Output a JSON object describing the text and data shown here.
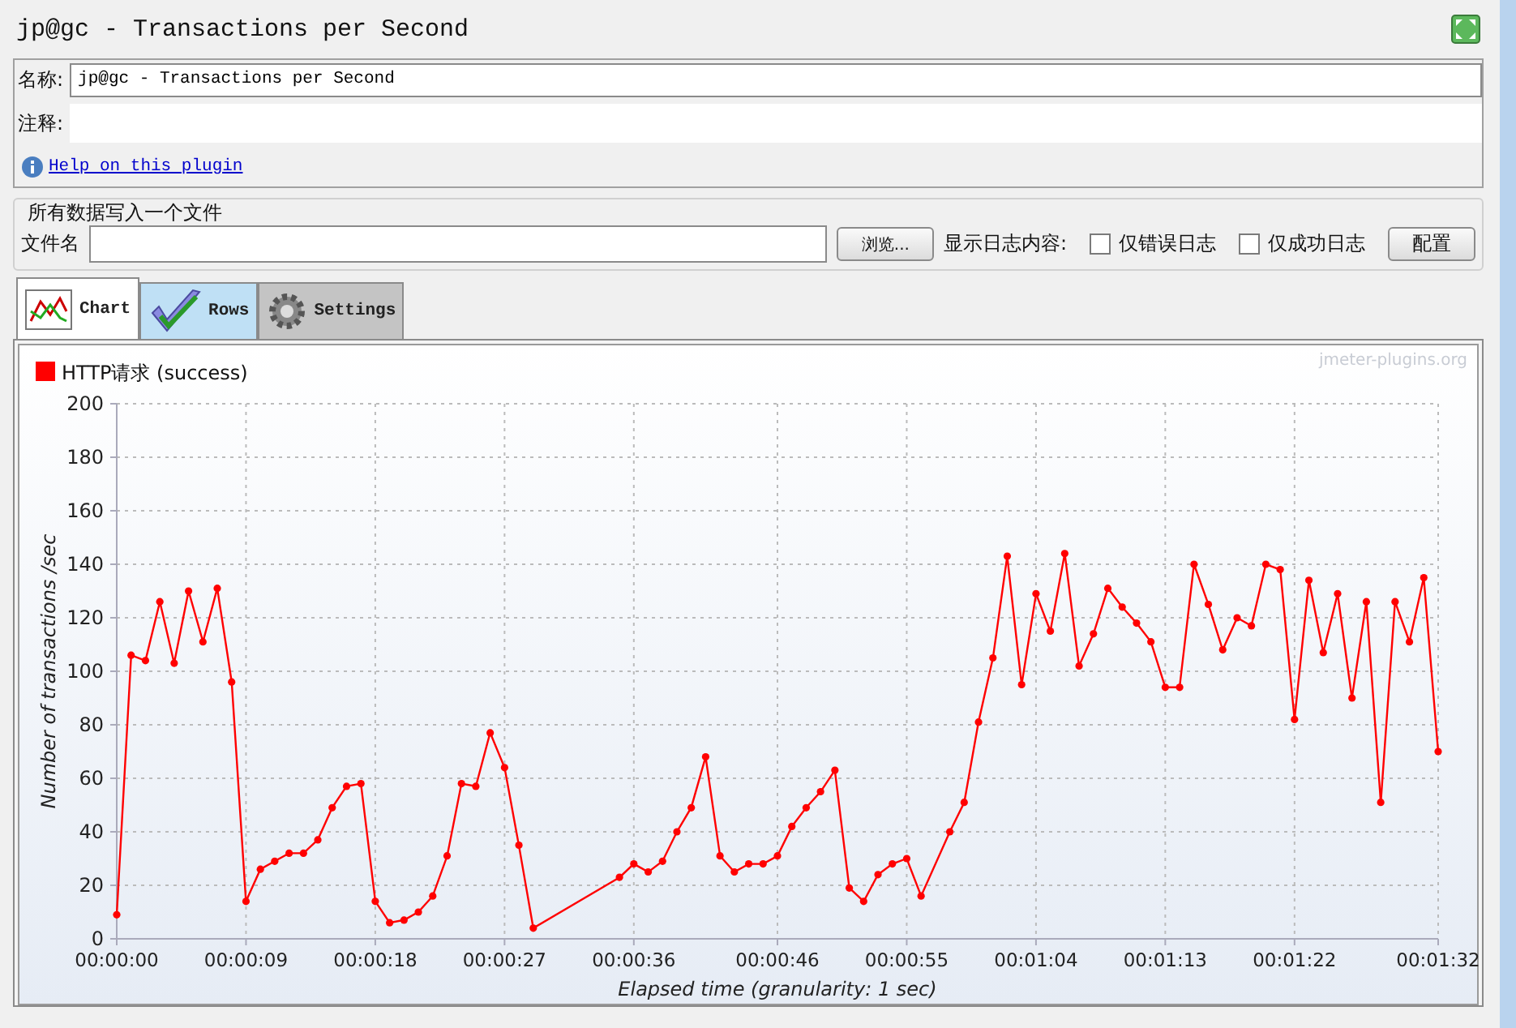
{
  "window": {
    "title": "jp@gc - Transactions per Second"
  },
  "name_field": {
    "label": "名称:",
    "value": "jp@gc - Transactions per Second"
  },
  "comment_field": {
    "label": "注释:"
  },
  "help_link": "Help on this plugin",
  "file_section": {
    "title": "所有数据写入一个文件",
    "filename_label": "文件名",
    "browse_button": "浏览...",
    "log_label": "显示日志内容:",
    "config_button": "配置",
    "checkboxes": [
      {
        "label": "仅错误日志",
        "checked": false
      },
      {
        "label": "仅成功日志",
        "checked": false
      }
    ]
  },
  "tabs": [
    {
      "label": "Chart",
      "kind": "chart",
      "selected": true
    },
    {
      "label": "Rows",
      "kind": "rows",
      "selected": false
    },
    {
      "label": "Settings",
      "kind": "settings",
      "selected": false
    }
  ],
  "chart": {
    "credit": "jmeter-plugins.org",
    "chart_data": {
      "type": "line",
      "grid": true,
      "xlabel": "Elapsed time (granularity: 1 sec)",
      "ylabel": "Number of transactions /sec",
      "x": [
        0,
        1,
        2,
        3,
        4,
        5,
        6,
        7,
        8,
        9,
        10,
        11,
        12,
        13,
        14,
        15,
        16,
        17,
        18,
        19,
        20,
        21,
        22,
        23,
        24,
        25,
        26,
        27,
        28,
        29,
        35,
        36,
        37,
        38,
        39,
        40,
        41,
        42,
        43,
        44,
        45,
        46,
        47,
        48,
        49,
        50,
        51,
        52,
        53,
        54,
        55,
        56,
        58,
        59,
        60,
        61,
        62,
        63,
        64,
        65,
        66,
        67,
        68,
        69,
        70,
        71,
        72,
        73,
        74,
        75,
        76,
        77,
        78,
        79,
        80,
        81,
        82,
        83,
        84,
        85,
        86,
        87,
        88,
        89,
        90,
        91,
        92
      ],
      "series": [
        {
          "name": "HTTP请求 (success)",
          "color": "#ff0000",
          "marker": true,
          "values": [
            9,
            106,
            104,
            126,
            103,
            130,
            111,
            131,
            96,
            14,
            26,
            29,
            32,
            32,
            37,
            49,
            57,
            58,
            14,
            6,
            7,
            10,
            16,
            31,
            58,
            57,
            77,
            64,
            35,
            4,
            23,
            28,
            25,
            29,
            40,
            49,
            68,
            31,
            25,
            28,
            28,
            31,
            42,
            49,
            55,
            63,
            19,
            14,
            24,
            28,
            30,
            16,
            40,
            51,
            81,
            105,
            143,
            95,
            129,
            115,
            144,
            102,
            114,
            131,
            124,
            118,
            111,
            94,
            94,
            140,
            125,
            108,
            120,
            117,
            140,
            138,
            82,
            134,
            107,
            129,
            90,
            126,
            51,
            126,
            111,
            135,
            70
          ]
        }
      ],
      "xlim": [
        0,
        92
      ],
      "ylim": [
        0,
        200
      ],
      "yticks": [
        0,
        20,
        40,
        60,
        80,
        100,
        120,
        140,
        160,
        180,
        200
      ],
      "xticks": [
        {
          "value": 0,
          "label": "00:00:00"
        },
        {
          "value": 9,
          "label": "00:00:09"
        },
        {
          "value": 18,
          "label": "00:00:18"
        },
        {
          "value": 27,
          "label": "00:00:27"
        },
        {
          "value": 36,
          "label": "00:00:36"
        },
        {
          "value": 46,
          "label": "00:00:46"
        },
        {
          "value": 55,
          "label": "00:00:55"
        },
        {
          "value": 64,
          "label": "00:01:04"
        },
        {
          "value": 73,
          "label": "00:01:13"
        },
        {
          "value": 82,
          "label": "00:01:22"
        },
        {
          "value": 92,
          "label": "00:01:32"
        }
      ]
    }
  }
}
